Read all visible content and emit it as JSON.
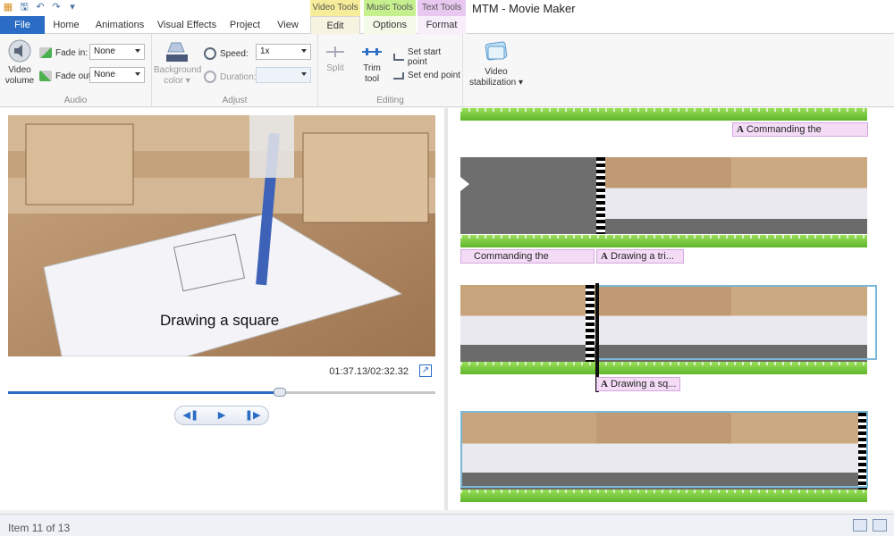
{
  "app": {
    "title": "MTM - Movie Maker",
    "context_groups": {
      "video_tools": "Video Tools",
      "music_tools": "Music Tools",
      "text_tools": "Text Tools"
    }
  },
  "tabs": [
    {
      "label": "File"
    },
    {
      "label": "Home"
    },
    {
      "label": "Animations"
    },
    {
      "label": "Visual Effects"
    },
    {
      "label": "Project"
    },
    {
      "label": "View"
    },
    {
      "label": "Edit"
    },
    {
      "label": "Options"
    },
    {
      "label": "Format"
    }
  ],
  "ribbon": {
    "audio": {
      "group_label": "Audio",
      "video_volume_label": "Video volume",
      "fade_in_label": "Fade in:",
      "fade_in_value": "None",
      "fade_out_label": "Fade out:",
      "fade_out_value": "None"
    },
    "adjust": {
      "group_label": "Adjust",
      "background_color_label": "Background color",
      "speed_label": "Speed:",
      "speed_value": "1x",
      "duration_label": "Duration:",
      "duration_value": ""
    },
    "editing": {
      "group_label": "Editing",
      "split_label": "Split",
      "trim_tool_label": "Trim tool",
      "set_start_label": "Set start point",
      "set_end_label": "Set end point"
    },
    "stabilization": {
      "label": "Video stabilization"
    }
  },
  "preview": {
    "caption": "Drawing a square",
    "time": "01:37.13/02:32.32",
    "progress_fraction": 0.635
  },
  "storyboard": {
    "captions": {
      "row1": "Commanding the",
      "row2a": "Commanding the",
      "row2b": "Drawing a tri...",
      "row3": "Drawing a sq..."
    }
  },
  "status": {
    "item_text": "Item 11 of 13"
  },
  "colors": {
    "file_tab": "#2b6cc4",
    "video_tools": "#f6ec9a",
    "music_tools": "#c6ef8e",
    "text_tools": "#e8c8f0",
    "audio_track": "#6cc234",
    "caption_bg": "#f4dcf7",
    "selection": "#7ab8d8"
  },
  "icons": {
    "qat": [
      "movie-maker-icon",
      "save-icon",
      "undo-icon",
      "redo-icon",
      "customize-icon"
    ]
  }
}
